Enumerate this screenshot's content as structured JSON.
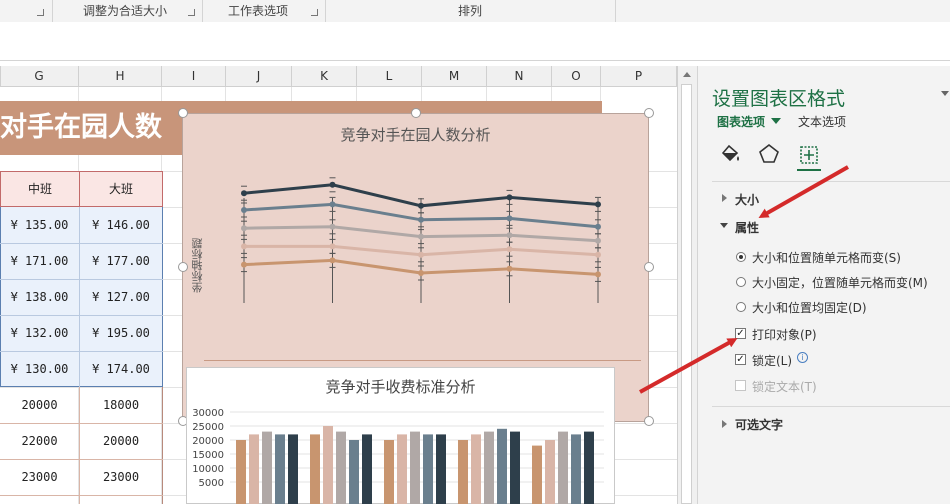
{
  "ribbon": {
    "groups": [
      "调整为合适大小",
      "工作表选项",
      "排列"
    ]
  },
  "columns": [
    "G",
    "H",
    "I",
    "J",
    "K",
    "L",
    "M",
    "N",
    "O",
    "P"
  ],
  "sheet": {
    "banner_text": "对手在园人数",
    "header": [
      "中班",
      "大班"
    ],
    "money_rows": [
      [
        "¥ 135.00",
        "¥ 146.00"
      ],
      [
        "¥ 171.00",
        "¥ 177.00"
      ],
      [
        "¥ 138.00",
        "¥ 127.00"
      ],
      [
        "¥ 132.00",
        "¥ 195.00"
      ],
      [
        "¥ 130.00",
        "¥ 174.00"
      ]
    ],
    "number_rows": [
      [
        "20000",
        "18000"
      ],
      [
        "22000",
        "20000"
      ],
      [
        "23000",
        "23000"
      ]
    ]
  },
  "chart1": {
    "title": "竞争对手在园人数分析",
    "ylabel": "坐标轴标题"
  },
  "chart2": {
    "title": "竞争对手收费标准分析",
    "yticks": [
      "30000",
      "25000",
      "20000",
      "15000",
      "10000",
      "5000"
    ]
  },
  "chart_data": [
    {
      "type": "line",
      "title": "竞争对手在园人数分析",
      "ylabel": "坐标轴标题",
      "x": [
        1,
        2,
        3,
        4,
        5
      ],
      "ylim": [
        0,
        100
      ],
      "series": [
        {
          "color": "#2e3f4b",
          "values": [
            82,
            88,
            73,
            79,
            74
          ]
        },
        {
          "color": "#6a7f8e",
          "values": [
            70,
            74,
            63,
            64,
            58
          ]
        },
        {
          "color": "#b0a8a6",
          "values": [
            57,
            58,
            51,
            52,
            48
          ]
        },
        {
          "color": "#d9b5a7",
          "values": [
            44,
            44,
            38,
            42,
            38
          ]
        },
        {
          "color": "#c8956f",
          "values": [
            31,
            34,
            25,
            28,
            24
          ]
        }
      ]
    },
    {
      "type": "bar",
      "title": "竞争对手收费标准分析",
      "ylim": [
        0,
        30000
      ],
      "categories": [
        "1",
        "2",
        "3",
        "4",
        "5"
      ],
      "series": [
        {
          "color": "#c8956f",
          "values": [
            20000,
            22000,
            20000,
            20000,
            18000
          ]
        },
        {
          "color": "#d9b5a7",
          "values": [
            22000,
            25000,
            22000,
            22000,
            20000
          ]
        },
        {
          "color": "#b0a8a6",
          "values": [
            23000,
            23000,
            23000,
            23000,
            23000
          ]
        },
        {
          "color": "#6a7f8e",
          "values": [
            22000,
            20000,
            22000,
            24000,
            22000
          ]
        },
        {
          "color": "#2e3f4b",
          "values": [
            22000,
            22000,
            22000,
            23000,
            23000
          ]
        }
      ]
    }
  ],
  "panel": {
    "title": "设置图表区格式",
    "tab_chart_options": "图表选项",
    "tab_text_options": "文本选项",
    "section_size": "大小",
    "section_properties": "属性",
    "radio1": "大小和位置随单元格而变(S)",
    "radio2": "大小固定，位置随单元格而变(M)",
    "radio3": "大小和位置均固定(D)",
    "check_print": "打印对象(P)",
    "check_lock": "锁定(L)",
    "check_lock_text": "锁定文本(T)",
    "section_alt_text": "可选文字",
    "accent_color": "#1e7145",
    "arrow_color": "#d42a2a"
  }
}
